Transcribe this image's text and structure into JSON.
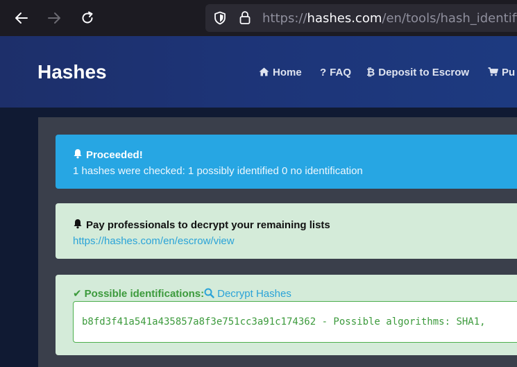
{
  "browser": {
    "url_prefix": "https://",
    "url_host": "hashes.com",
    "url_path": "/en/tools/hash_identifier"
  },
  "header": {
    "brand": "Hashes",
    "nav": [
      {
        "label": "Home",
        "icon": "home-icon"
      },
      {
        "label": "FAQ",
        "icon": "question-icon"
      },
      {
        "label": "Deposit to Escrow",
        "icon": "bitcoin-icon"
      },
      {
        "label": "Pu",
        "icon": "cart-icon"
      }
    ]
  },
  "alerts": {
    "info": {
      "title": "Proceeded!",
      "text": "1 hashes were checked: 1 possibly identified 0 no identification"
    },
    "pay": {
      "title": "Pay professionals to decrypt your remaining lists",
      "link": "https://hashes.com/en/escrow/view"
    },
    "ident": {
      "title": "Possible identifications:",
      "link": "Decrypt Hashes",
      "result": "b8fd3f41a541a435857a8f3e751cc3a91c174362 - Possible algorithms: SHA1,"
    }
  },
  "colors": {
    "info_bg": "#27a6e3",
    "success_bg": "#d4ebd9",
    "success_text": "#3c9a3c",
    "link": "#2aa3d8",
    "header_bg": "#1d3477"
  }
}
